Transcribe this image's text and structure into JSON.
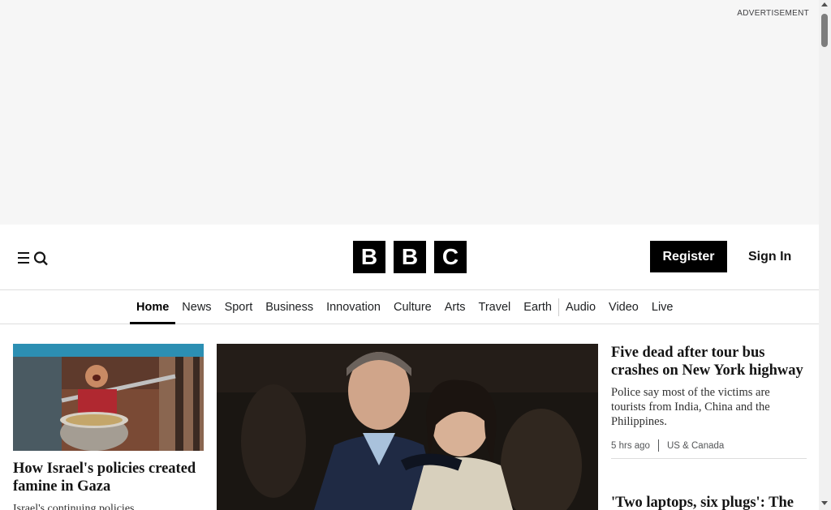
{
  "advertisement": {
    "label": "ADVERTISEMENT"
  },
  "header": {
    "menu_icon": "menu-search-icon",
    "logo_letters": [
      "B",
      "B",
      "C"
    ],
    "register_label": "Register",
    "signin_label": "Sign In"
  },
  "nav": {
    "items": [
      {
        "label": "Home",
        "active": true
      },
      {
        "label": "News"
      },
      {
        "label": "Sport"
      },
      {
        "label": "Business"
      },
      {
        "label": "Innovation"
      },
      {
        "label": "Culture"
      },
      {
        "label": "Arts"
      },
      {
        "label": "Travel"
      },
      {
        "label": "Earth"
      },
      {
        "label": "Audio"
      },
      {
        "label": "Video"
      },
      {
        "label": "Live"
      }
    ]
  },
  "stories": {
    "left": {
      "title": "How Israel's policies created famine in Gaza",
      "summary_partial": "Israel's continuing policies..."
    },
    "right": {
      "title": "Five dead after tour bus crashes on New York highway",
      "summary": "Police say most of the victims are tourists from India, China and the Philippines.",
      "time": "5 hrs ago",
      "section": "US & Canada"
    },
    "right_second": {
      "title": "'Two laptops, six plugs': The"
    }
  },
  "colors": {
    "accent": "#000000",
    "ad_background": "#f6f6f6",
    "divider": "#dddddd"
  }
}
